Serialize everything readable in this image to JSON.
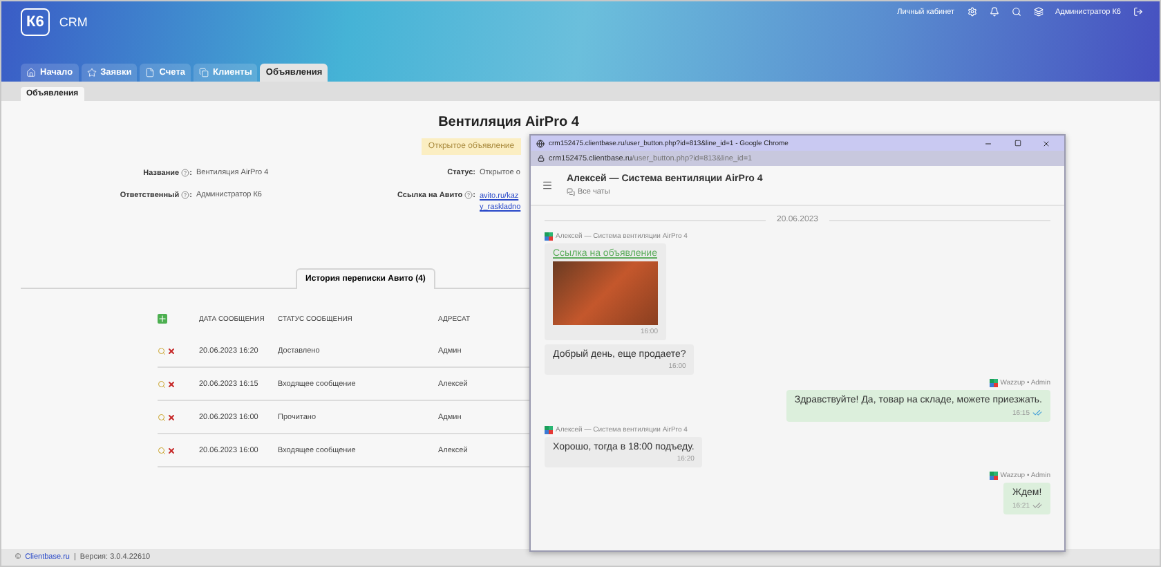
{
  "header": {
    "logo": "К6",
    "app_name": "CRM",
    "account_link": "Личный кабинет",
    "user": "Администратор К6"
  },
  "nav_tabs": [
    {
      "label": "Начало",
      "selected": false
    },
    {
      "label": "Заявки",
      "selected": false
    },
    {
      "label": "Счета",
      "selected": false
    },
    {
      "label": "Клиенты",
      "selected": false
    },
    {
      "label": "Объявления",
      "selected": true
    }
  ],
  "sub_tabs": [
    {
      "label": "Объявления",
      "selected": true
    }
  ],
  "record": {
    "title": "Вентиляция AirPro 4",
    "status_badge": "Открытое объявление",
    "fields_left": [
      {
        "label": "Название",
        "colon": ":",
        "value": "Вентиляция AirPro 4"
      },
      {
        "label": "Ответственный",
        "colon": ":",
        "value": "Администратор К6"
      }
    ],
    "fields_right": [
      {
        "label": "Статус:",
        "value": "Открытое о",
        "kind": "text"
      },
      {
        "label": "Ссылка на Авито",
        "colon": ":",
        "value": "avito.ru/kaz",
        "value_2": "y_raskladno",
        "kind": "link"
      }
    ]
  },
  "history_tabs": [
    {
      "label": "История переписки Авито (4)",
      "selected": true
    }
  ],
  "table": {
    "columns": [
      "ДАТА СООБЩЕНИЯ",
      "СТАТУС СООБЩЕНИЯ",
      "АДРЕСАТ"
    ],
    "rows": [
      [
        "20.06.2023 16:20",
        "Доставлено",
        "Админ"
      ],
      [
        "20.06.2023 16:15",
        "Входящее сообщение",
        "Алексей"
      ],
      [
        "20.06.2023 16:00",
        "Прочитано",
        "Админ"
      ],
      [
        "20.06.2023 16:00",
        "Входящее сообщение",
        "Алексей"
      ]
    ]
  },
  "footer": {
    "copyright": "©",
    "site": "Clientbase.ru",
    "separator": "|",
    "version": "Версия: 3.0.4.22610"
  },
  "popup": {
    "window_title": "crm152475.clientbase.ru/user_button.php?id=813&line_id=1 - Google Chrome",
    "url_host": "crm152475.clientbase.ru",
    "url_path": "/user_button.php?id=813&line_id=1",
    "chat_title": "Алексей — Система вентиляции AirPro 4",
    "all_chats": "Все чаты",
    "date": "20.06.2023",
    "messages": [
      {
        "kind": "incoming",
        "sender": "Алексей — Система вентиляции AirPro 4",
        "link": "Ссылка на объявление",
        "photo": true,
        "time": "16:00"
      },
      {
        "kind": "incoming",
        "text": "Добрый день, еще продаете?",
        "time": "16:00"
      },
      {
        "kind": "outgoing",
        "sender": "Wazzup • Admin",
        "text": "Здравствуйте! Да, товар на складе, можете приезжать.",
        "time": "16:15",
        "read": true
      },
      {
        "kind": "incoming",
        "sender": "Алексей — Система вентиляции AirPro 4",
        "text": "Хорошо, тогда в 18:00 подъеду.",
        "time": "16:20"
      },
      {
        "kind": "outgoing",
        "sender": "Wazzup • Admin",
        "text": "Ждем!",
        "time": "16:21",
        "read": false
      }
    ]
  }
}
